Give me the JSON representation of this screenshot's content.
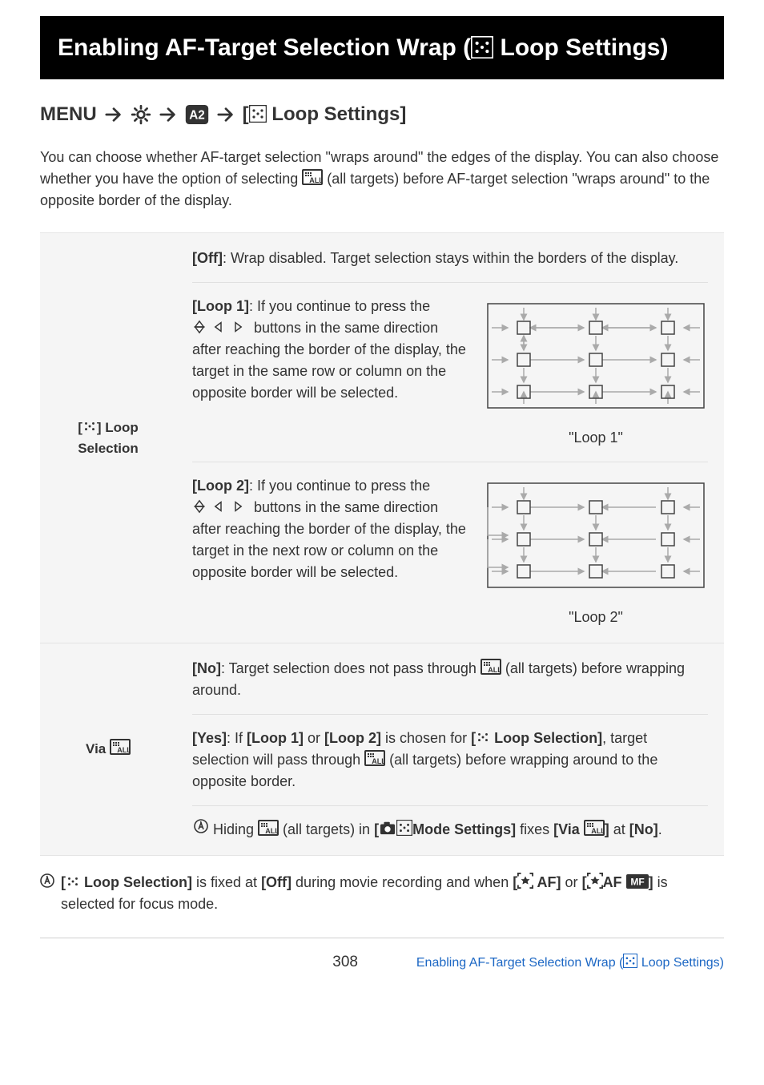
{
  "title": {
    "pre": "Enabling AF-Target Selection Wrap (",
    "post": " Loop Settings)"
  },
  "breadcrumb": {
    "menu": "MENU",
    "last_pre": "[",
    "last_post": " Loop Settings]"
  },
  "intro": {
    "p1a": "You can choose whether AF-target selection \"wraps around\" the edges of the display. You can also choose whether you have the option of selecting ",
    "p1b": " (all targets) before AF-target selection \"wraps around\" to the opposite border of the display."
  },
  "table": {
    "row1_label_pre": "[",
    "row1_label_post": "] Loop Selection",
    "off_b": "[Off]",
    "off_t": ": Wrap disabled. Target selection stays within the borders of the display.",
    "loop1_b": "[Loop 1]",
    "loop1_t": ": If you continue to press the ",
    "loop1_t2": " buttons in the same direction after reaching the border of the display, the target in the same row or column on the opposite border will be selected.",
    "loop1_cap": "\"Loop 1\"",
    "loop2_b": "[Loop 2]",
    "loop2_t": ": If you continue to press the ",
    "loop2_t2": " buttons in the same direction after reaching the border of the display, the target in the next row or column on the opposite border will be selected.",
    "loop2_cap": "\"Loop 2\"",
    "row2_label_pre": "Via ",
    "no_b": "[No]",
    "no_t1": ": Target selection does not pass through ",
    "no_t2": " (all targets) before wrapping around.",
    "yes_b": "[Yes]",
    "yes_t1": ": If ",
    "yes_t2": "[Loop 1]",
    "yes_t3": " or ",
    "yes_t4": "[Loop 2]",
    "yes_t5": " is chosen for ",
    "yes_t6": "[",
    "yes_t6b": " Loop Selection]",
    "yes_t7": ", target selection will pass through ",
    "yes_t8": " (all targets) before wrapping around to the opposite border.",
    "note1a": "Hiding ",
    "note1b": " (all targets) in ",
    "note1c": "[",
    "note1c2": "Mode Settings]",
    "note1e": " fixes ",
    "note1d": "[Via ",
    "note1d2": "]",
    "note1f": " at ",
    "note1g": "[No]",
    "note1h": "."
  },
  "footnote": {
    "a": "[",
    "a2": " Loop Selection]",
    "b": " is fixed at ",
    "c": "[Off]",
    "d": " during movie recording and when ",
    "e": "[",
    "e2": " AF]",
    "f": " or ",
    "g": "[",
    "g2": "AF ",
    "g3": "]",
    "h": " is selected for focus mode."
  },
  "footer": {
    "page": "308",
    "title_pre": "Enabling AF-Target Selection Wrap (",
    "title_post": " Loop Settings)"
  }
}
